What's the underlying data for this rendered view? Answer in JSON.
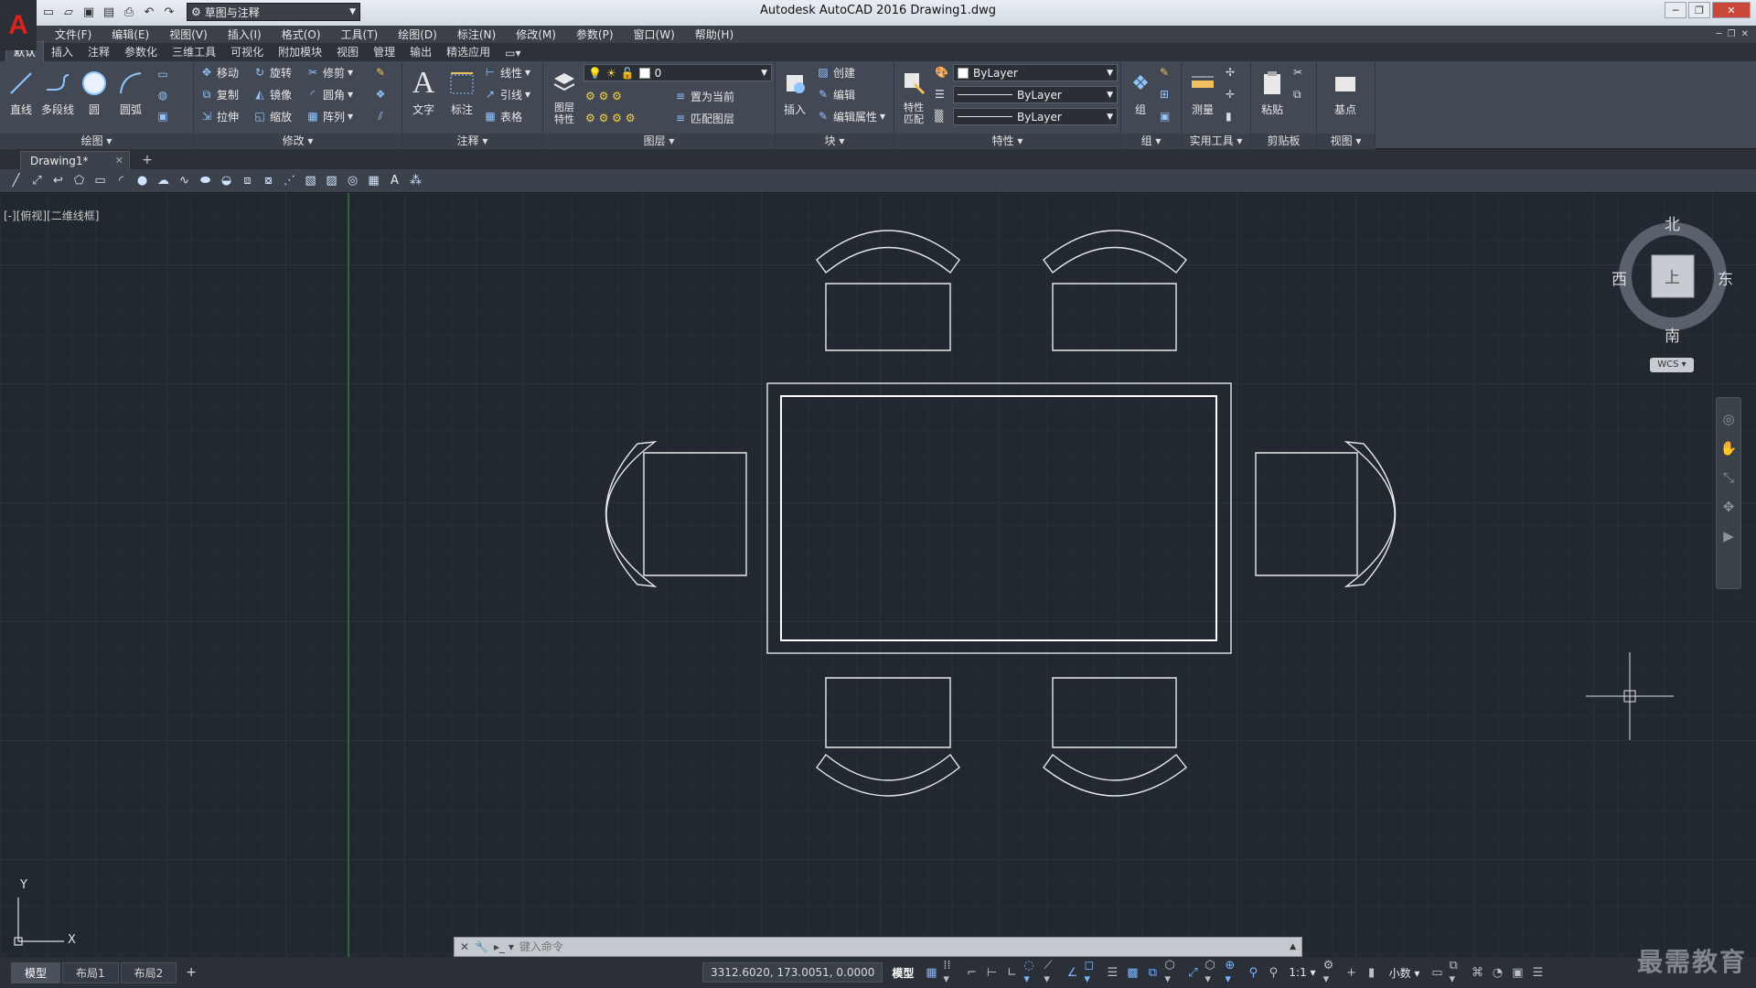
{
  "window": {
    "title": "Autodesk AutoCAD 2016    Drawing1.dwg",
    "workspace": "草图与注释"
  },
  "menus": [
    "文件(F)",
    "编辑(E)",
    "视图(V)",
    "插入(I)",
    "格式(O)",
    "工具(T)",
    "绘图(D)",
    "标注(N)",
    "修改(M)",
    "参数(P)",
    "窗口(W)",
    "帮助(H)"
  ],
  "ribbon_tabs": [
    "默认",
    "插入",
    "注释",
    "参数化",
    "三维工具",
    "可视化",
    "附加模块",
    "视图",
    "管理",
    "输出",
    "精选应用"
  ],
  "ribbon": {
    "draw": {
      "title": "绘图",
      "line": "直线",
      "polyline": "多段线",
      "circle": "圆",
      "arc": "圆弧"
    },
    "modify": {
      "title": "修改",
      "move": "移动",
      "rotate": "旋转",
      "trim": "修剪",
      "copy": "复制",
      "mirror": "镜像",
      "fillet": "圆角",
      "stretch": "拉伸",
      "scale": "缩放",
      "array": "阵列"
    },
    "annotation": {
      "title": "注释",
      "text": "文字",
      "dimension": "标注",
      "linear": "线性",
      "leader": "引线",
      "table": "表格"
    },
    "layers": {
      "title": "图层",
      "props": "图层\n特性",
      "current_layer": "0",
      "set_current": "置为当前",
      "match_layer": "匹配图层"
    },
    "block": {
      "title": "块",
      "insert": "插入",
      "create": "创建",
      "edit": "编辑",
      "edit_attr": "编辑属性"
    },
    "properties": {
      "title": "特性",
      "match": "特性\n匹配",
      "color": "ByLayer",
      "linetype": "ByLayer",
      "lineweight": "ByLayer"
    },
    "groups": {
      "title": "组",
      "group": "组"
    },
    "utilities": {
      "title": "实用工具",
      "measure": "测量"
    },
    "clipboard": {
      "title": "剪贴板",
      "paste": "粘贴"
    },
    "view": {
      "title": "视图",
      "base": "基点"
    }
  },
  "file_tab": "Drawing1*",
  "viewport_label": "[-][俯视][二维线框]",
  "viewcube": {
    "north": "北",
    "south": "南",
    "east": "东",
    "west": "西",
    "face": "上",
    "wcs": "WCS"
  },
  "command_placeholder": "键入命令",
  "layout_tabs": [
    "模型",
    "布局1",
    "布局2"
  ],
  "status": {
    "coords": "3312.6020, 173.0051, 0.0000",
    "model": "模型",
    "scale": "1:1",
    "units": "小数"
  },
  "watermark": "最需教育",
  "ucs": {
    "x": "X",
    "y": "Y"
  }
}
